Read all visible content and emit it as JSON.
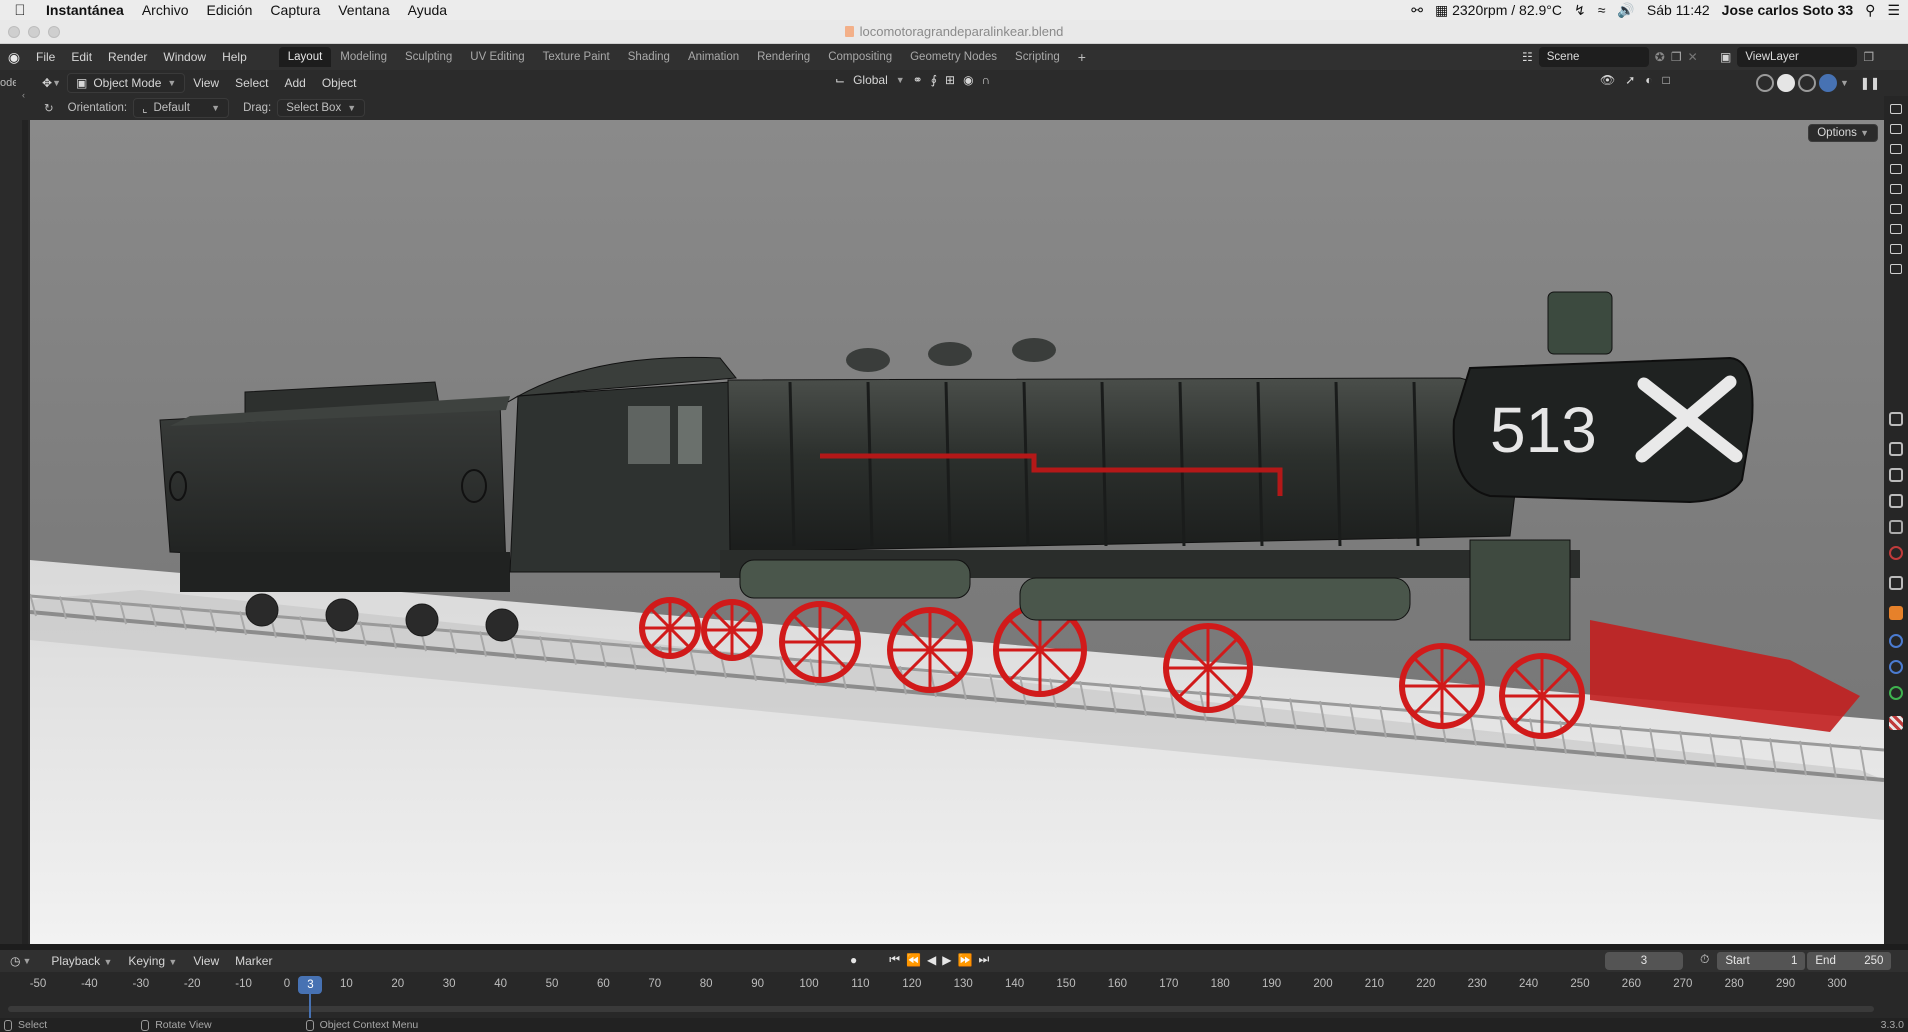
{
  "macos": {
    "menus": [
      "Instantánea",
      "Archivo",
      "Edición",
      "Captura",
      "Ventana",
      "Ayuda"
    ],
    "status": {
      "fan": "2320rpm / 82.9°C",
      "clock": "Sáb 11:42",
      "user": "Jose carlos Soto 33"
    }
  },
  "window": {
    "title": "locomotoragrandeparalinkear.blend"
  },
  "blender": {
    "top_menu": [
      "File",
      "Edit",
      "Render",
      "Window",
      "Help"
    ],
    "workspaces": [
      "Layout",
      "Modeling",
      "Sculpting",
      "UV Editing",
      "Texture Paint",
      "Shading",
      "Animation",
      "Rendering",
      "Compositing",
      "Geometry Nodes",
      "Scripting"
    ],
    "active_workspace": "Layout",
    "scene": "Scene",
    "view_layer": "ViewLayer",
    "left_edge_label": "ode"
  },
  "viewport_header": {
    "mode": "Object Mode",
    "menus": [
      "View",
      "Select",
      "Add",
      "Object"
    ],
    "transform_orientation": "Global"
  },
  "tool_settings": {
    "orientation_label": "Orientation:",
    "orientation_value": "Default",
    "drag_label": "Drag:",
    "drag_value": "Select Box",
    "options": "Options"
  },
  "model": {
    "number_plate": "513"
  },
  "timeline": {
    "menus": [
      "Playback",
      "Keying",
      "View",
      "Marker"
    ],
    "current_frame": "3",
    "start_label": "Start",
    "start": "1",
    "end_label": "End",
    "end": "250",
    "ruler": [
      "-50",
      "-40",
      "-30",
      "-20",
      "-10",
      "0",
      "10",
      "20",
      "30",
      "40",
      "50",
      "60",
      "70",
      "80",
      "90",
      "100",
      "110",
      "120",
      "130",
      "140",
      "150",
      "160",
      "170",
      "180",
      "190",
      "200",
      "210",
      "220",
      "230",
      "240",
      "250",
      "260",
      "270",
      "280",
      "290",
      "300"
    ]
  },
  "statusbar": {
    "select": "Select",
    "rotate": "Rotate View",
    "context": "Object Context Menu",
    "version": "3.3.0"
  },
  "colors": {
    "accent": "#4772b3",
    "wheel_red": "#d11a1a",
    "body_dark": "#2a2d2b"
  }
}
